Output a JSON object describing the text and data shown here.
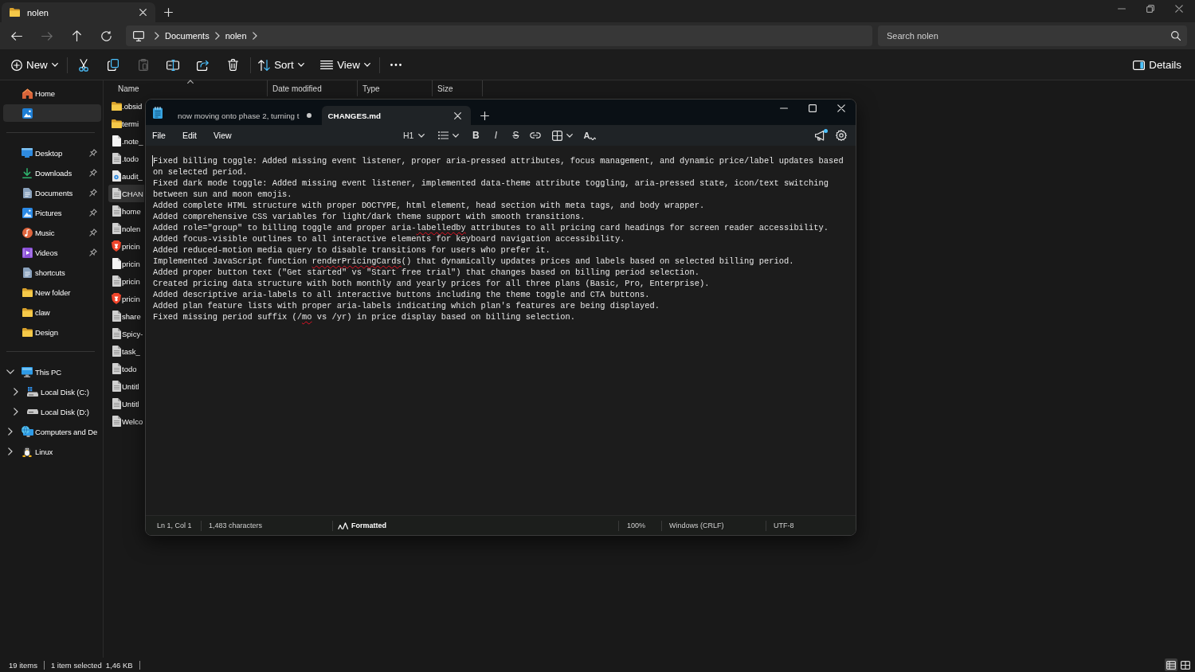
{
  "explorer": {
    "tabs": [
      {
        "title": "nolen",
        "selected": true
      }
    ],
    "nav": [
      {
        "kind": "back",
        "disabled": false
      },
      {
        "kind": "forward",
        "disabled": true
      },
      {
        "kind": "up",
        "disabled": false
      },
      {
        "kind": "refresh",
        "disabled": false
      }
    ],
    "breadcrumbs": [
      "Documents",
      "nolen"
    ],
    "search": {
      "placeholder": "Search nolen"
    },
    "toolbar": [
      {
        "items": [
          {
            "kind": "new",
            "label": "New",
            "dropdown": true,
            "disabled": false
          }
        ]
      },
      {
        "items": [
          {
            "kind": "cut",
            "dropdown": false,
            "disabled": false
          },
          {
            "kind": "copy",
            "dropdown": false,
            "disabled": false
          },
          {
            "kind": "paste",
            "dropdown": false,
            "disabled": true
          },
          {
            "kind": "rename",
            "dropdown": false,
            "disabled": false
          },
          {
            "kind": "share",
            "dropdown": false,
            "disabled": false
          },
          {
            "kind": "delete",
            "dropdown": false,
            "disabled": false
          }
        ]
      },
      {
        "items": [
          {
            "kind": "sort",
            "label": "Sort",
            "dropdown": true,
            "disabled": false
          },
          {
            "kind": "view",
            "label": "View",
            "dropdown": true,
            "disabled": false
          }
        ]
      },
      {
        "items": [
          {
            "kind": "more",
            "dropdown": false,
            "disabled": false
          }
        ]
      }
    ],
    "details": {
      "label": "Details"
    },
    "sidebar": {
      "sections": [
        {
          "items": [
            {
              "label": "Home",
              "kind": "home",
              "pinned": false,
              "selected": false
            },
            {
              "kind": "gallery",
              "pinned": false,
              "selected": true
            }
          ]
        },
        {
          "items": [
            {
              "label": "Desktop",
              "kind": "desktop",
              "pinned": true,
              "selected": false
            },
            {
              "label": "Downloads",
              "kind": "downloads",
              "pinned": true,
              "selected": false
            },
            {
              "label": "Documents",
              "kind": "documents",
              "pinned": true,
              "selected": false
            },
            {
              "label": "Pictures",
              "kind": "pictures",
              "pinned": true,
              "selected": false
            },
            {
              "label": "Music",
              "kind": "music",
              "pinned": true,
              "selected": false
            },
            {
              "label": "Videos",
              "kind": "videos",
              "pinned": true,
              "selected": false
            },
            {
              "label": "shortcuts",
              "kind": "document",
              "pinned": false,
              "selected": false
            },
            {
              "label": "New folder",
              "kind": "folder",
              "pinned": false,
              "selected": false
            },
            {
              "label": "claw",
              "kind": "folder",
              "pinned": false,
              "selected": false
            },
            {
              "label": "Design",
              "kind": "folder",
              "pinned": false,
              "selected": false
            }
          ]
        },
        {
          "items": [
            {
              "label": "This PC",
              "kind": "pc",
              "expanded": true,
              "selected": false,
              "children": [
                {
                  "label": "Local Disk (C:)",
                  "kind": "system-drive",
                  "expanded": false,
                  "selected": false
                },
                {
                  "label": "Local Disk (D:)",
                  "kind": "drive",
                  "expanded": false,
                  "selected": false
                }
              ]
            },
            {
              "label": "Computers and De",
              "kind": "network",
              "expanded": false,
              "selected": false
            },
            {
              "label": "Linux",
              "kind": "linux",
              "expanded": false,
              "selected": false
            }
          ]
        }
      ]
    },
    "columns": [
      {
        "label": "Name",
        "sorted": true
      },
      {
        "label": "Date modified",
        "sorted": false
      },
      {
        "label": "Type",
        "sorted": false
      },
      {
        "label": "Size",
        "sorted": false
      }
    ],
    "files": [
      {
        "name": ".obsid",
        "kind": "folder",
        "selected": false
      },
      {
        "name": "termi",
        "kind": "folder",
        "selected": false
      },
      {
        "name": ".note_",
        "kind": "blank-file",
        "selected": false
      },
      {
        "name": ".todo",
        "kind": "text-file",
        "selected": false
      },
      {
        "name": "audit_",
        "kind": "script",
        "selected": false
      },
      {
        "name": "CHAN",
        "kind": "text-file",
        "selected": true
      },
      {
        "name": "home",
        "kind": "text-file",
        "selected": false
      },
      {
        "name": "nolen",
        "kind": "text-file",
        "selected": false
      },
      {
        "name": "pricin",
        "kind": "web-page",
        "selected": false
      },
      {
        "name": "pricin",
        "kind": "blank-file",
        "selected": false
      },
      {
        "name": "pricin",
        "kind": "text-file",
        "selected": false
      },
      {
        "name": "pricin",
        "kind": "web-page",
        "selected": false
      },
      {
        "name": "share",
        "kind": "text-file",
        "selected": false
      },
      {
        "name": "Spicy-",
        "kind": "text-file",
        "selected": false
      },
      {
        "name": "task_",
        "kind": "text-file",
        "selected": false
      },
      {
        "name": "todo",
        "kind": "text-file",
        "selected": false
      },
      {
        "name": "Untitl",
        "kind": "text-file",
        "selected": false
      },
      {
        "name": "Untitl",
        "kind": "text-file",
        "selected": false
      },
      {
        "name": "Welco",
        "kind": "text-file",
        "selected": false
      }
    ],
    "status_bar": {
      "item_count": "19 items",
      "selection": "1 item selected",
      "size": "1,46 KB"
    },
    "view_modes": [
      {
        "kind": "details",
        "selected": true
      },
      {
        "kind": "tiles",
        "selected": false
      }
    ]
  },
  "notepad": {
    "tabs": [
      {
        "title": "now moving onto phase 2, turning t",
        "unsaved": true,
        "selected": false
      },
      {
        "title": "CHANGES.md",
        "unsaved": false,
        "selected": true
      }
    ],
    "menu": [
      "File",
      "Edit",
      "View"
    ],
    "format_toolbar": [
      {
        "kind": "heading",
        "label": "H1",
        "dropdown": true
      },
      {
        "kind": "list",
        "dropdown": true
      },
      {
        "kind": "bold",
        "label": "B",
        "dropdown": false
      },
      {
        "kind": "italic",
        "label": "I",
        "dropdown": false
      },
      {
        "kind": "strikethrough",
        "label": "S",
        "dropdown": false
      },
      {
        "kind": "link",
        "dropdown": false
      },
      {
        "kind": "table",
        "dropdown": true
      },
      {
        "kind": "spelling",
        "label": "A",
        "dropdown": false
      }
    ],
    "announcements": {
      "unread": true
    },
    "paragraphs": [
      {
        "runs": [
          {
            "text": "Fixed billing toggle: Added missing event listener, proper aria-pressed attributes, focus management, and dynamic price/label updates based on selected period.",
            "misspelled": false
          }
        ]
      },
      {
        "runs": [
          {
            "text": "Fixed dark mode toggle: Added missing event listener, implemented data-theme attribute toggling, aria-pressed state, icon/text switching between sun and moon emojis.",
            "misspelled": false
          }
        ]
      },
      {
        "runs": [
          {
            "text": "Added complete HTML structure with proper DOCTYPE, html element, head section with meta tags, and body wrapper.",
            "misspelled": false
          }
        ]
      },
      {
        "runs": [
          {
            "text": "Added comprehensive CSS variables for light/dark theme support with smooth transitions.",
            "misspelled": false
          }
        ]
      },
      {
        "runs": [
          {
            "text": "Added role=\"group\" to billing toggle and proper aria-",
            "misspelled": false
          },
          {
            "text": "labelledby",
            "misspelled": true
          },
          {
            "text": " attributes to all pricing card headings for screen reader accessibility.",
            "misspelled": false
          }
        ]
      },
      {
        "runs": [
          {
            "text": "Added focus-visible outlines to all interactive elements for keyboard navigation accessibility.",
            "misspelled": false
          }
        ]
      },
      {
        "runs": [
          {
            "text": "Added reduced-motion media query to disable transitions for users who prefer it.",
            "misspelled": false
          }
        ]
      },
      {
        "runs": [
          {
            "text": "Implemented JavaScript function ",
            "misspelled": false
          },
          {
            "text": "renderPricingCards",
            "misspelled": true
          },
          {
            "text": "() that dynamically updates prices and labels based on selected billing period.",
            "misspelled": false
          }
        ]
      },
      {
        "runs": [
          {
            "text": "Added proper button text (\"Get started\" vs \"Start free trial\") that changes based on billing period selection.",
            "misspelled": false
          }
        ]
      },
      {
        "runs": [
          {
            "text": "Created pricing data structure with both monthly and yearly prices for all three plans (Basic, Pro, Enterprise).",
            "misspelled": false
          }
        ]
      },
      {
        "runs": [
          {
            "text": "Added descriptive aria-labels to all interactive buttons including the theme toggle and CTA buttons.",
            "misspelled": false
          }
        ]
      },
      {
        "runs": [
          {
            "text": "Added plan feature lists with proper aria-labels indicating which plan's features are being displayed.",
            "misspelled": false
          }
        ]
      },
      {
        "runs": [
          {
            "text": "Fixed missing period suffix (/",
            "misspelled": false
          },
          {
            "text": "mo",
            "misspelled": true
          },
          {
            "text": " vs /yr) in price display based on billing selection.",
            "misspelled": false
          }
        ]
      }
    ],
    "status_bar": {
      "position": "Ln 1, Col 1",
      "characters": "1,483 characters",
      "mode": "Formatted",
      "zoom": "100%",
      "line_ending": "Windows (CRLF)",
      "encoding": "UTF-8"
    }
  }
}
